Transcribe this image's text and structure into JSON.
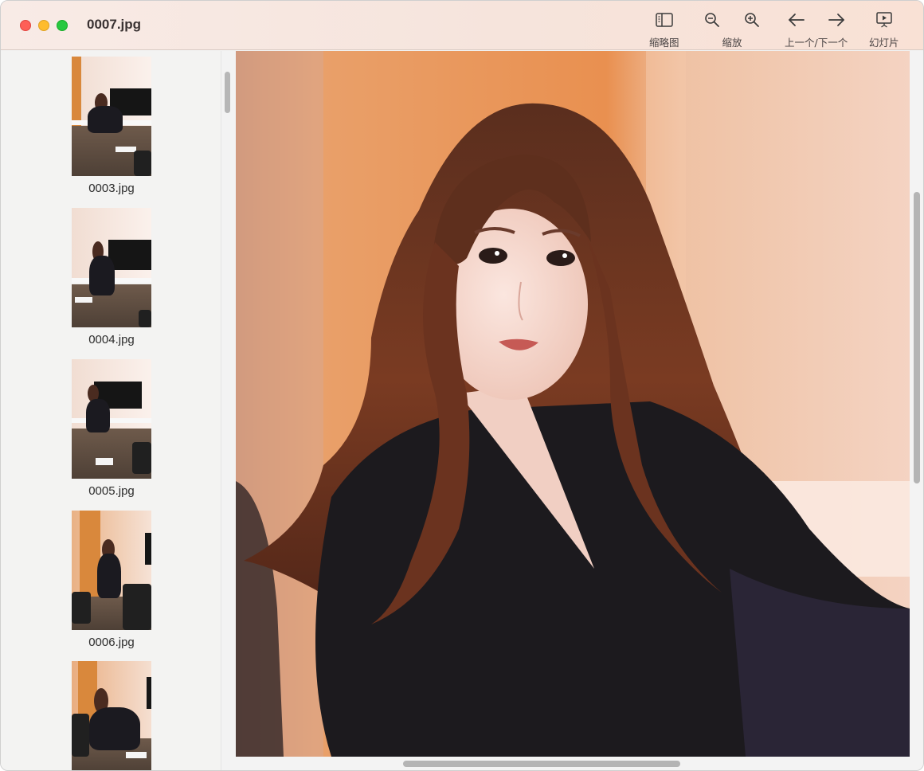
{
  "window": {
    "title": "0007.jpg"
  },
  "toolbar": {
    "thumbnails": {
      "label": "缩略图",
      "icon": "sidebar-icon"
    },
    "zoom": {
      "label": "缩放",
      "icons": [
        "zoom-out-icon",
        "zoom-in-icon"
      ]
    },
    "navigate": {
      "label": "上一个/下一个",
      "icons": [
        "arrow-left-icon",
        "arrow-right-icon"
      ]
    },
    "slideshow": {
      "label": "幻灯片",
      "icon": "slideshow-icon"
    }
  },
  "sidebar": {
    "items": [
      {
        "label": "0003.jpg"
      },
      {
        "label": "0004.jpg"
      },
      {
        "label": "0005.jpg"
      },
      {
        "label": "0006.jpg"
      },
      {
        "label": ""
      }
    ]
  },
  "colors": {
    "close": "#fe5f57",
    "minimize": "#febc2e",
    "maximize": "#28c840",
    "titlebar": "#f6e4dc"
  }
}
